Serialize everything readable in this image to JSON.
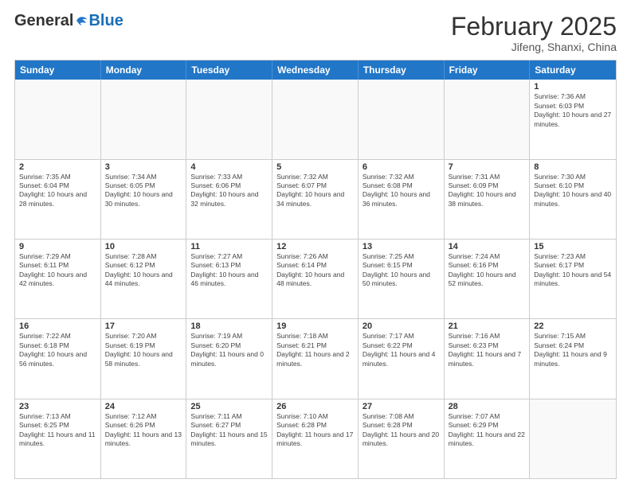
{
  "logo": {
    "general": "General",
    "blue": "Blue"
  },
  "title": "February 2025",
  "location": "Jifeng, Shanxi, China",
  "header_days": [
    "Sunday",
    "Monday",
    "Tuesday",
    "Wednesday",
    "Thursday",
    "Friday",
    "Saturday"
  ],
  "weeks": [
    [
      {
        "day": "",
        "info": ""
      },
      {
        "day": "",
        "info": ""
      },
      {
        "day": "",
        "info": ""
      },
      {
        "day": "",
        "info": ""
      },
      {
        "day": "",
        "info": ""
      },
      {
        "day": "",
        "info": ""
      },
      {
        "day": "1",
        "info": "Sunrise: 7:36 AM\nSunset: 6:03 PM\nDaylight: 10 hours and 27 minutes."
      }
    ],
    [
      {
        "day": "2",
        "info": "Sunrise: 7:35 AM\nSunset: 6:04 PM\nDaylight: 10 hours and 28 minutes."
      },
      {
        "day": "3",
        "info": "Sunrise: 7:34 AM\nSunset: 6:05 PM\nDaylight: 10 hours and 30 minutes."
      },
      {
        "day": "4",
        "info": "Sunrise: 7:33 AM\nSunset: 6:06 PM\nDaylight: 10 hours and 32 minutes."
      },
      {
        "day": "5",
        "info": "Sunrise: 7:32 AM\nSunset: 6:07 PM\nDaylight: 10 hours and 34 minutes."
      },
      {
        "day": "6",
        "info": "Sunrise: 7:32 AM\nSunset: 6:08 PM\nDaylight: 10 hours and 36 minutes."
      },
      {
        "day": "7",
        "info": "Sunrise: 7:31 AM\nSunset: 6:09 PM\nDaylight: 10 hours and 38 minutes."
      },
      {
        "day": "8",
        "info": "Sunrise: 7:30 AM\nSunset: 6:10 PM\nDaylight: 10 hours and 40 minutes."
      }
    ],
    [
      {
        "day": "9",
        "info": "Sunrise: 7:29 AM\nSunset: 6:11 PM\nDaylight: 10 hours and 42 minutes."
      },
      {
        "day": "10",
        "info": "Sunrise: 7:28 AM\nSunset: 6:12 PM\nDaylight: 10 hours and 44 minutes."
      },
      {
        "day": "11",
        "info": "Sunrise: 7:27 AM\nSunset: 6:13 PM\nDaylight: 10 hours and 46 minutes."
      },
      {
        "day": "12",
        "info": "Sunrise: 7:26 AM\nSunset: 6:14 PM\nDaylight: 10 hours and 48 minutes."
      },
      {
        "day": "13",
        "info": "Sunrise: 7:25 AM\nSunset: 6:15 PM\nDaylight: 10 hours and 50 minutes."
      },
      {
        "day": "14",
        "info": "Sunrise: 7:24 AM\nSunset: 6:16 PM\nDaylight: 10 hours and 52 minutes."
      },
      {
        "day": "15",
        "info": "Sunrise: 7:23 AM\nSunset: 6:17 PM\nDaylight: 10 hours and 54 minutes."
      }
    ],
    [
      {
        "day": "16",
        "info": "Sunrise: 7:22 AM\nSunset: 6:18 PM\nDaylight: 10 hours and 56 minutes."
      },
      {
        "day": "17",
        "info": "Sunrise: 7:20 AM\nSunset: 6:19 PM\nDaylight: 10 hours and 58 minutes."
      },
      {
        "day": "18",
        "info": "Sunrise: 7:19 AM\nSunset: 6:20 PM\nDaylight: 11 hours and 0 minutes."
      },
      {
        "day": "19",
        "info": "Sunrise: 7:18 AM\nSunset: 6:21 PM\nDaylight: 11 hours and 2 minutes."
      },
      {
        "day": "20",
        "info": "Sunrise: 7:17 AM\nSunset: 6:22 PM\nDaylight: 11 hours and 4 minutes."
      },
      {
        "day": "21",
        "info": "Sunrise: 7:16 AM\nSunset: 6:23 PM\nDaylight: 11 hours and 7 minutes."
      },
      {
        "day": "22",
        "info": "Sunrise: 7:15 AM\nSunset: 6:24 PM\nDaylight: 11 hours and 9 minutes."
      }
    ],
    [
      {
        "day": "23",
        "info": "Sunrise: 7:13 AM\nSunset: 6:25 PM\nDaylight: 11 hours and 11 minutes."
      },
      {
        "day": "24",
        "info": "Sunrise: 7:12 AM\nSunset: 6:26 PM\nDaylight: 11 hours and 13 minutes."
      },
      {
        "day": "25",
        "info": "Sunrise: 7:11 AM\nSunset: 6:27 PM\nDaylight: 11 hours and 15 minutes."
      },
      {
        "day": "26",
        "info": "Sunrise: 7:10 AM\nSunset: 6:28 PM\nDaylight: 11 hours and 17 minutes."
      },
      {
        "day": "27",
        "info": "Sunrise: 7:08 AM\nSunset: 6:28 PM\nDaylight: 11 hours and 20 minutes."
      },
      {
        "day": "28",
        "info": "Sunrise: 7:07 AM\nSunset: 6:29 PM\nDaylight: 11 hours and 22 minutes."
      },
      {
        "day": "",
        "info": ""
      }
    ]
  ]
}
